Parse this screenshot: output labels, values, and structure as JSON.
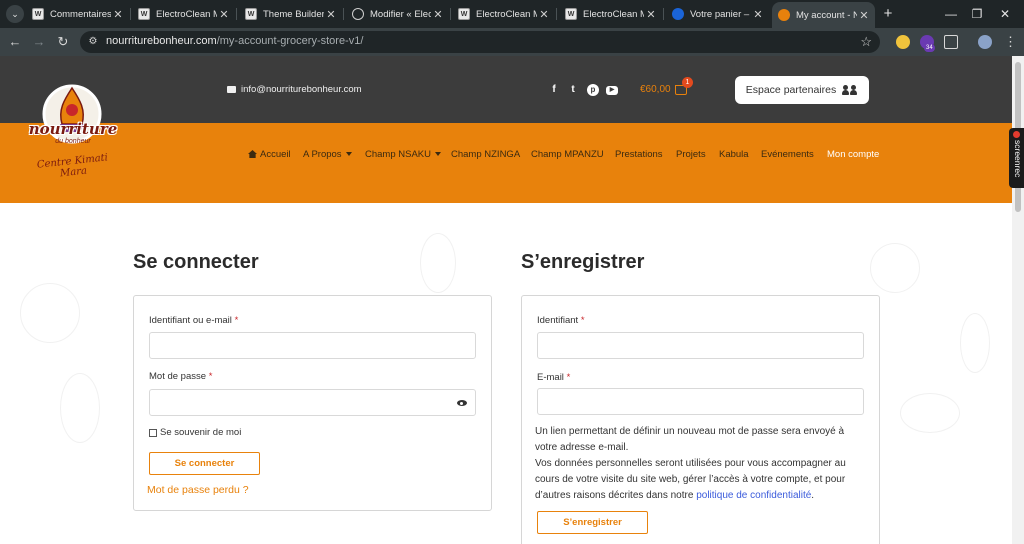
{
  "browser": {
    "tabs": [
      {
        "title": "Commentaires ‹",
        "favicon": "wp-icon"
      },
      {
        "title": "ElectroClean Ma",
        "favicon": "wp-icon"
      },
      {
        "title": "Theme Builder ‹",
        "favicon": "wp-icon"
      },
      {
        "title": "Modifier « Electr",
        "favicon": "globe-icon"
      },
      {
        "title": "ElectroClean Ma",
        "favicon": "wp-icon"
      },
      {
        "title": "ElectroClean Ma",
        "favicon": "wp-icon"
      },
      {
        "title": "Votre panier – el",
        "favicon": "blue-icon"
      },
      {
        "title": "My account - No",
        "favicon": "orange-icon"
      }
    ],
    "url_host": "nourriturebonheur.com",
    "url_path": "/my-account-grocery-store-v1/",
    "ext_badge": "34"
  },
  "header": {
    "email": "info@nourriturebonheur.com",
    "social": [
      "f",
      "t",
      "p",
      "▶"
    ],
    "cart_total": "€60,00",
    "cart_count": "1",
    "partner_button": "Espace partenaires"
  },
  "logo": {
    "name": "nourriture",
    "tagline": "du bonheur",
    "script": "Centre Kimati Mara"
  },
  "nav": {
    "items": [
      {
        "label": "Accueil",
        "dropdown": false
      },
      {
        "label": "A Propos",
        "dropdown": true
      },
      {
        "label": "Champ NSAKU",
        "dropdown": true
      },
      {
        "label": "Champ NZINGA",
        "dropdown": false
      },
      {
        "label": "Champ MPANZU",
        "dropdown": false
      },
      {
        "label": "Prestations",
        "dropdown": false
      },
      {
        "label": "Projets",
        "dropdown": false
      },
      {
        "label": "Kabula",
        "dropdown": false
      },
      {
        "label": "Evénements",
        "dropdown": false
      },
      {
        "label": "Mon compte",
        "dropdown": false
      }
    ],
    "current": "Mon compte"
  },
  "login": {
    "title": "Se connecter",
    "username_label": "Identifiant ou e-mail",
    "password_label": "Mot de passe",
    "required_mark": "*",
    "remember_label": "Se souvenir de moi",
    "submit_label": "Se connecter",
    "lost_password": "Mot de passe perdu ?"
  },
  "register": {
    "title": "S’enregistrer",
    "username_label": "Identifiant",
    "email_label": "E-mail",
    "required_mark": "*",
    "info_line1": "Un lien permettant de définir un nouveau mot de passe sera envoyé à votre adresse e-mail.",
    "info_line2_prefix": "Vos données personnelles seront utilisées pour vous accompagner au cours de votre visite du site web, gérer l’accès à votre compte, et pour d’autres raisons décrites dans notre ",
    "privacy_link": "politique de confidentialité",
    "info_line2_suffix": ".",
    "submit_label": "S’enregistrer"
  },
  "extension": {
    "screenrec": "screenrec"
  },
  "colors": {
    "accent": "#e8820c",
    "topbar": "#3c3c3c",
    "link": "#3b5bdb"
  }
}
